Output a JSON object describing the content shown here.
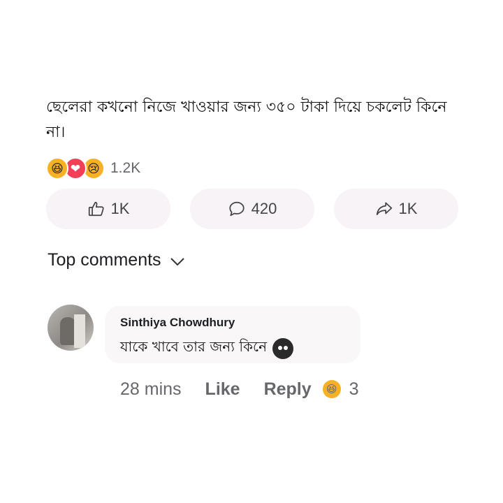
{
  "post": {
    "text": "ছেলেরা কখনো নিজে খাওয়ার জন্য ৩৫০ টাকা দিয়ে চকলেট কিনে না।",
    "reactions": {
      "icons": [
        "haha-icon",
        "love-icon",
        "sad-icon"
      ],
      "count": "1.2K"
    },
    "actions": {
      "like_count": "1K",
      "comment_count": "420",
      "share_count": "1K"
    }
  },
  "comments_header": {
    "label": "Top comments"
  },
  "comment": {
    "author": "Sinthiya Chowdhury",
    "text": "যাকে খাবে তার জন্য কিনে",
    "time": "28 mins",
    "like_label": "Like",
    "reply_label": "Reply",
    "reaction_count": "3"
  },
  "colors": {
    "reaction_yellow": "#f7b125",
    "reaction_red": "#f33e58",
    "muted_text": "#65676b",
    "bubble_bg": "#faf7f9"
  }
}
